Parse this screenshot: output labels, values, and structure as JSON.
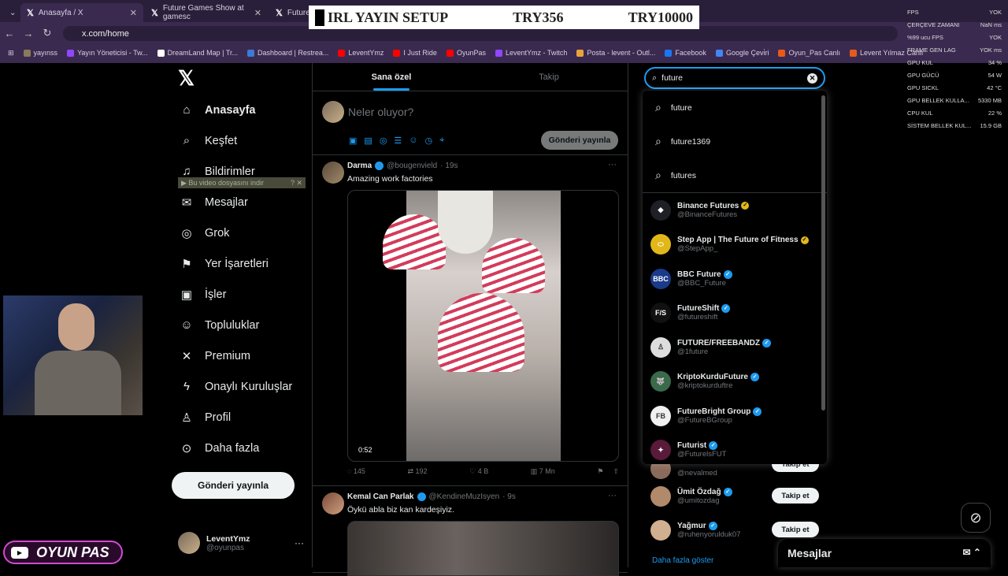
{
  "browser": {
    "tabs": [
      {
        "title": "Anasayfa / X",
        "active": true
      },
      {
        "title": "Future Games Show at gamesc",
        "active": false
      },
      {
        "title": "Future",
        "active": false
      }
    ],
    "url": "x.com/home",
    "bookmarks": [
      {
        "label": "yayınss",
        "color": "#8a7a5a"
      },
      {
        "label": "Yayın Yöneticisi - Tw...",
        "color": "#9146ff"
      },
      {
        "label": "DreamLand Map | Tr...",
        "color": "#ffffff"
      },
      {
        "label": "Dashboard | Restrea...",
        "color": "#3a7bd5"
      },
      {
        "label": "LeventYmz",
        "color": "#ff0000"
      },
      {
        "label": "I Just Ride",
        "color": "#ff0000"
      },
      {
        "label": "OyunPas",
        "color": "#ff0000"
      },
      {
        "label": "LeventYmz - Twitch",
        "color": "#9146ff"
      },
      {
        "label": "Posta - levent - Outl...",
        "color": "#e8a33a"
      },
      {
        "label": "Facebook",
        "color": "#1877f2"
      },
      {
        "label": "Google Çevi̇ri",
        "color": "#4285f4"
      },
      {
        "label": "Oyun_Pas Canlı",
        "color": "#e85a1a"
      },
      {
        "label": "Levent Yılmaz Canlı",
        "color": "#e85a1a"
      }
    ]
  },
  "overlay": {
    "left": "IRL YAYIN SETUP",
    "middle": "TRY356",
    "right": "TRY10000"
  },
  "stats": [
    {
      "label": "FPS",
      "value": "YOK"
    },
    {
      "label": "ÇERÇEVE ZAMANI",
      "value": "NaN ms"
    },
    {
      "label": "%99 ucu FPS",
      "value": "YOK"
    },
    {
      "label": "FRAME GEN LAG",
      "value": "YOK ms"
    },
    {
      "label": "GPU KUL",
      "value": "34 %"
    },
    {
      "label": "GPU GÜCÜ",
      "value": "54 W"
    },
    {
      "label": "GPU SICKL",
      "value": "42 °C"
    },
    {
      "label": "GPU BELLEK KULLA...",
      "value": "5330 MB"
    },
    {
      "label": "CPU KUL",
      "value": "22 %"
    },
    {
      "label": "SİSTEM BELLEK KUL...",
      "value": "15.9 GB"
    }
  ],
  "sidebar": {
    "items": [
      {
        "label": "Anasayfa",
        "icon": "home-icon",
        "glyph": "⌂",
        "bold": true
      },
      {
        "label": "Keşfet",
        "icon": "search-icon",
        "glyph": "⌕"
      },
      {
        "label": "Bildirimler",
        "icon": "bell-icon",
        "glyph": "♫"
      },
      {
        "label": "Mesajlar",
        "icon": "envelope-icon",
        "glyph": "✉"
      },
      {
        "label": "Grok",
        "icon": "grok-icon",
        "glyph": "◎"
      },
      {
        "label": "Yer İşaretleri",
        "icon": "bookmark-icon",
        "glyph": "⚑"
      },
      {
        "label": "İşler",
        "icon": "briefcase-icon",
        "glyph": "▣"
      },
      {
        "label": "Topluluklar",
        "icon": "people-icon",
        "glyph": "☺"
      },
      {
        "label": "Premium",
        "icon": "x-icon",
        "glyph": "✕"
      },
      {
        "label": "Onaylı Kuruluşlar",
        "icon": "lightning-icon",
        "glyph": "ϟ"
      },
      {
        "label": "Profil",
        "icon": "person-icon",
        "glyph": "♙"
      },
      {
        "label": "Daha fazla",
        "icon": "more-circle-icon",
        "glyph": "⊙"
      }
    ],
    "post_button": "Gönderi yayınla",
    "user": {
      "name": "LeventYmz",
      "handle": "@oyunpas",
      "more": "···"
    }
  },
  "webcam_brand": "OYUN PAS",
  "main": {
    "tabs": [
      {
        "label": "Sana özel",
        "active": true
      },
      {
        "label": "Takip",
        "active": false
      }
    ],
    "composer": {
      "placeholder": "Neler oluyor?",
      "post_button": "Gönderi yayınla"
    },
    "tweets": [
      {
        "name": "Darma",
        "handle": "@bougenvield",
        "time": "· 19s",
        "text": "Amazing work factories",
        "duration": "0:52",
        "replies": "145",
        "retweets": "192",
        "likes": "4 B",
        "views": "7 Mn",
        "overlay": "▶ Bu video dosyasını indir"
      },
      {
        "name": "Kemal Can Parlak",
        "handle": "@KendineMuzIsyen",
        "time": "· 9s",
        "text": "Öykü abla biz kan kardeşiyiz."
      }
    ]
  },
  "search": {
    "value": "future",
    "suggestions": [
      "future",
      "future1369",
      "futures"
    ],
    "accounts": [
      {
        "name": "Binance Futures",
        "handle": "@BinanceFutures",
        "badge": "gold",
        "av_color": "#1e2026",
        "av_text": "◆"
      },
      {
        "name": "Step App | The Future of Fitness",
        "handle": "@StepApp_",
        "badge": "gold",
        "av_color": "#e2b719",
        "av_text": "⬭"
      },
      {
        "name": "BBC Future",
        "handle": "@BBC_Future",
        "badge": "blue",
        "av_color": "#1a3a8a",
        "av_text": "BBC"
      },
      {
        "name": "FutureShift",
        "handle": "@futureshift",
        "badge": "blue",
        "av_color": "#111111",
        "av_text": "F/S"
      },
      {
        "name": "FUTURE/FREEBANDZ",
        "handle": "@1future",
        "badge": "blue",
        "av_color": "#dddddd",
        "av_text": "♙"
      },
      {
        "name": "KriptoKurduFuture",
        "handle": "@kriptokurduftre",
        "badge": "blue",
        "av_color": "#3a6a4a",
        "av_text": "🐺"
      },
      {
        "name": "FutureBright Group",
        "handle": "@FutureBGroup",
        "badge": "blue",
        "av_color": "#f0f0f0",
        "av_text": "FB"
      },
      {
        "name": "Futurist",
        "handle": "@FuturelsFUT",
        "badge": "blue",
        "av_color": "#5a1a3a",
        "av_text": "✦"
      }
    ]
  },
  "who_to_follow": [
    {
      "name": "",
      "handle": "@nevalmed",
      "button": "Takip et"
    },
    {
      "name": "Ümit Özdağ",
      "handle": "@umitozdag",
      "button": "Takip et"
    },
    {
      "name": "Yağmur",
      "handle": "@ruhenyorulduk07",
      "button": "Takip et"
    }
  ],
  "show_more": "Daha fazla göster",
  "messages_bar": "Mesajlar"
}
